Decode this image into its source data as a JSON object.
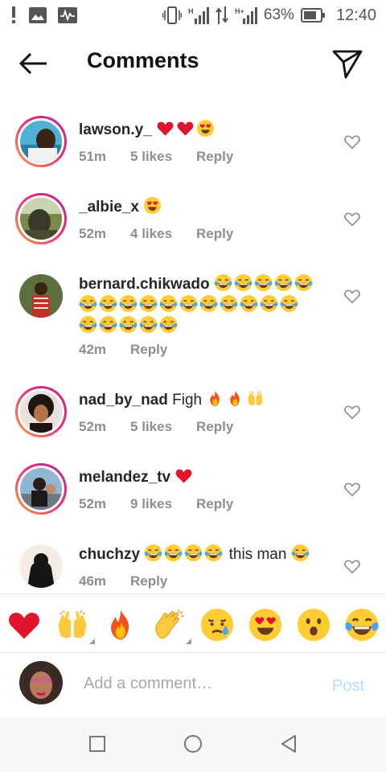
{
  "status_bar": {
    "battery_percent": "63%",
    "time": "12:40",
    "icons": [
      "alert-icon",
      "gallery-icon",
      "activity-icon",
      "vibrate-icon",
      "signal-h-icon",
      "data-arrows-icon",
      "signal-hplus-icon",
      "battery-icon"
    ]
  },
  "header": {
    "title": "Comments",
    "back_icon": "arrow-left-icon",
    "share_icon": "send-icon"
  },
  "comments": [
    {
      "username": "lawson.y_",
      "text": "",
      "emojis": [
        "red-heart",
        "red-heart",
        "heart-eyes"
      ],
      "time": "51m",
      "likes": "5 likes",
      "reply": "Reply"
    },
    {
      "username": "_albie_x",
      "text": "",
      "emojis": [
        "heart-eyes"
      ],
      "time": "52m",
      "likes": "4 likes",
      "reply": "Reply"
    },
    {
      "username": "bernard.chikwado",
      "text": "",
      "emojis_line1": 5,
      "emojis_line2": 11,
      "emojis_line3": 5,
      "emoji": "tears-of-joy",
      "time": "42m",
      "likes": "",
      "reply": "Reply"
    },
    {
      "username": "nad_by_nad",
      "text": "Figh",
      "emojis": [
        "fire",
        "fire",
        "raising-hands"
      ],
      "time": "52m",
      "likes": "5 likes",
      "reply": "Reply"
    },
    {
      "username": "melandez_tv",
      "text": "",
      "emojis": [
        "red-heart"
      ],
      "time": "52m",
      "likes": "9 likes",
      "reply": "Reply"
    },
    {
      "username": "chuchzy",
      "text_after": "this man",
      "emojis_before": 4,
      "emojis_after": 1,
      "emoji": "tears-of-joy",
      "time": "46m",
      "likes": "",
      "reply": "Reply"
    }
  ],
  "quick_emojis": [
    "red-heart",
    "raising-hands",
    "fire",
    "clapping-hands",
    "crying-face",
    "heart-eyes",
    "surprised-face",
    "tears-of-joy"
  ],
  "composer": {
    "placeholder": "Add a comment…",
    "post_label": "Post"
  },
  "navbar": {
    "icons": [
      "recents-square-icon",
      "home-circle-icon",
      "back-triangle-icon"
    ]
  },
  "colors": {
    "ring_start": "#f9a13a",
    "ring_end": "#b9258f",
    "meta_gray": "#8e8e8e",
    "post_disabled": "#b2dffc"
  }
}
